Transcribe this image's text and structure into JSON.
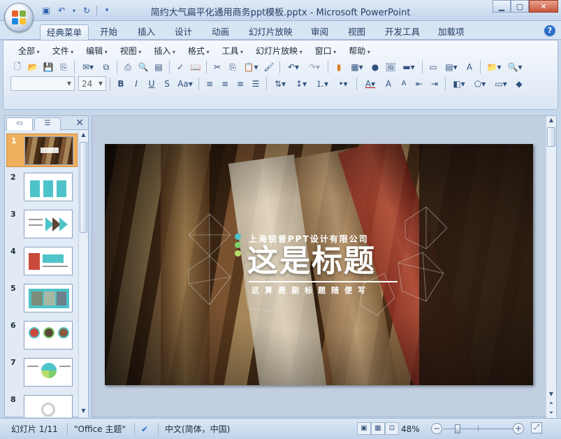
{
  "window": {
    "title": "简约大气扁平化通用商务ppt模板.pptx - Microsoft PowerPoint"
  },
  "qat": {
    "icons": [
      "save-icon",
      "undo-icon",
      "redo-icon",
      "customize-icon"
    ]
  },
  "tabs": [
    {
      "label": "经典菜单",
      "active": true
    },
    {
      "label": "开始"
    },
    {
      "label": "插入"
    },
    {
      "label": "设计"
    },
    {
      "label": "动画"
    },
    {
      "label": "幻灯片放映"
    },
    {
      "label": "审阅"
    },
    {
      "label": "视图"
    },
    {
      "label": "开发工具"
    },
    {
      "label": "加载项"
    }
  ],
  "menus": [
    "全部",
    "文件",
    "编辑",
    "视图",
    "插入",
    "格式",
    "工具",
    "幻灯片放映",
    "窗口",
    "帮助"
  ],
  "format": {
    "font_name": "",
    "font_size": "24"
  },
  "panel": {
    "close_glyph": "✕"
  },
  "slides": [
    {
      "num": "1",
      "selected": true
    },
    {
      "num": "2"
    },
    {
      "num": "3"
    },
    {
      "num": "4"
    },
    {
      "num": "5"
    },
    {
      "num": "6"
    },
    {
      "num": "7"
    },
    {
      "num": "8"
    }
  ],
  "slide": {
    "company": "上海锐普PPT设计有限公司",
    "title": "这是标题",
    "subtitle": "这算是副标题随便写",
    "dot_colors": [
      "#4ec3c9",
      "#7dd06a",
      "#b7e06a"
    ]
  },
  "status": {
    "slide_info": "幻灯片 1/11",
    "theme": "\"Office 主题\"",
    "language": "中文(简体，中国)",
    "zoom": "48%"
  },
  "colors": {
    "accent_blue": "#2d6fc8",
    "selected_orange": "#f0b05f"
  }
}
